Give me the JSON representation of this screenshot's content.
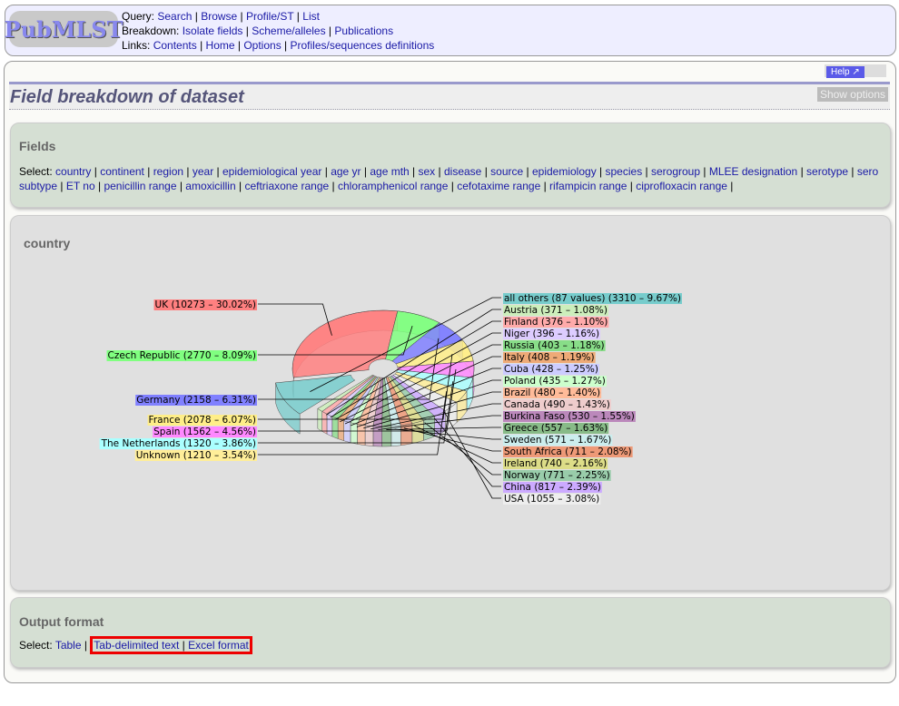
{
  "header": {
    "logo": "PubMLST",
    "query_label": "Query:",
    "query_links": [
      "Search",
      "Browse",
      "Profile/ST",
      "List"
    ],
    "breakdown_label": "Breakdown:",
    "breakdown_links": [
      "Isolate fields",
      "Scheme/alleles",
      "Publications"
    ],
    "links_label": "Links:",
    "links_links": [
      "Contents",
      "Home",
      "Options",
      "Profiles/sequences definitions"
    ]
  },
  "help_label": "Help",
  "page_title": "Field breakdown of dataset",
  "show_options_label": "Show options",
  "fields": {
    "heading": "Fields",
    "select_label": "Select:",
    "items": [
      "country",
      "continent",
      "region",
      "year",
      "epidemiological year",
      "age yr",
      "age mth",
      "sex",
      "disease",
      "source",
      "epidemiology",
      "species",
      "serogroup",
      "MLEE designation",
      "serotype",
      "sero subtype",
      "ET no",
      "penicillin range",
      "amoxicillin",
      "ceftriaxone range",
      "chloramphenicol range",
      "cefotaxime range",
      "rifampicin range",
      "ciprofloxacin range"
    ]
  },
  "chart_section_title": "country",
  "output": {
    "heading": "Output format",
    "select_label": "Select:",
    "items": [
      "Table",
      "Tab-delimited text",
      "Excel format"
    ]
  },
  "chart_data": {
    "type": "pie",
    "title": "country",
    "labels": [
      "UK",
      "Czech Republic",
      "Germany",
      "France",
      "Spain",
      "The Netherlands",
      "Unknown",
      "USA",
      "China",
      "Norway",
      "Ireland",
      "South Africa",
      "Sweden",
      "Greece",
      "Burkina Faso",
      "Canada",
      "Brazil",
      "Poland",
      "Cuba",
      "Italy",
      "Russia",
      "Niger",
      "Finland",
      "Austria",
      "all others (87 values)"
    ],
    "values": [
      10273,
      2770,
      2158,
      2078,
      1562,
      1320,
      1210,
      1055,
      817,
      771,
      740,
      711,
      571,
      557,
      530,
      490,
      480,
      435,
      428,
      408,
      403,
      396,
      376,
      371,
      3310
    ],
    "percents": [
      30.02,
      8.09,
      6.31,
      6.07,
      4.56,
      3.86,
      3.54,
      3.08,
      2.39,
      2.25,
      2.16,
      2.08,
      1.67,
      1.63,
      1.55,
      1.43,
      1.4,
      1.27,
      1.25,
      1.19,
      1.18,
      1.16,
      1.1,
      1.08,
      9.67
    ],
    "colors": [
      "#ff8080",
      "#80ff80",
      "#8080ff",
      "#ffee88",
      "#ff88ff",
      "#aaffff",
      "#ffee99",
      "#eeeeee",
      "#ccaaff",
      "#99ccaa",
      "#dddd88",
      "#ee9977",
      "#cceeee",
      "#88bb88",
      "#bb88bb",
      "#eecccc",
      "#ffbb99",
      "#ccffcc",
      "#ccccff",
      "#eeaa77",
      "#88dd88",
      "#ddccff",
      "#ffaaaa",
      "#cceebb",
      "#77cccc"
    ],
    "legend": "leader-labels"
  }
}
